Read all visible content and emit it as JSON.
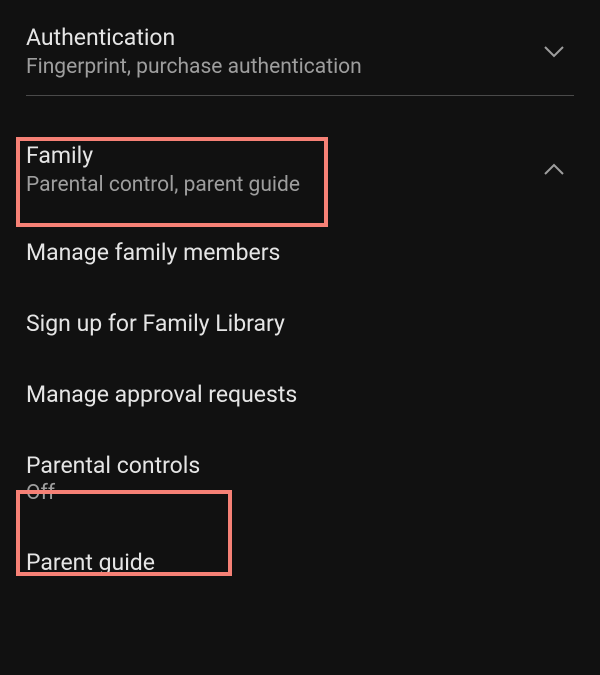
{
  "authentication": {
    "title": "Authentication",
    "subtitle": "Fingerprint, purchase authentication"
  },
  "family": {
    "title": "Family",
    "subtitle": "Parental control, parent guide",
    "items": [
      {
        "label": "Manage family members"
      },
      {
        "label": "Sign up for Family Library"
      },
      {
        "label": "Manage approval requests"
      },
      {
        "label": "Parental controls",
        "status": "Off"
      },
      {
        "label": "Parent guide"
      }
    ]
  }
}
